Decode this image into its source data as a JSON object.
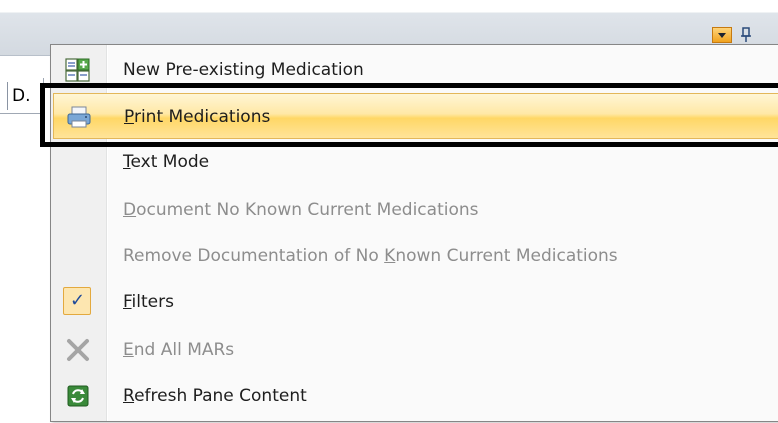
{
  "background": {
    "column_cell_text": "D."
  },
  "menu": {
    "items": [
      {
        "prefix": "",
        "hotkey": "",
        "rest": "New Pre-existing Medication",
        "icon": "new-medication-icon",
        "enabled": true,
        "highlighted": false,
        "checked": false
      },
      {
        "prefix": "",
        "hotkey": "P",
        "rest": "rint Medications",
        "icon": "print-icon",
        "enabled": true,
        "highlighted": true,
        "checked": false
      },
      {
        "prefix": "",
        "hotkey": "T",
        "rest": "ext Mode",
        "icon": "",
        "enabled": true,
        "highlighted": false,
        "checked": false
      },
      {
        "prefix": "",
        "hotkey": "D",
        "rest": "ocument No Known Current Medications",
        "icon": "",
        "enabled": false,
        "highlighted": false,
        "checked": false
      },
      {
        "prefix": "Remove Documentation of No ",
        "hotkey": "K",
        "rest": "nown Current Medications",
        "icon": "",
        "enabled": false,
        "highlighted": false,
        "checked": false
      },
      {
        "prefix": "",
        "hotkey": "F",
        "rest": "ilters",
        "icon": "checkmark-icon",
        "enabled": true,
        "highlighted": false,
        "checked": true
      },
      {
        "prefix": "",
        "hotkey": "E",
        "rest": "nd All MARs",
        "icon": "x-icon",
        "enabled": false,
        "highlighted": false,
        "checked": false
      },
      {
        "prefix": "",
        "hotkey": "R",
        "rest": "efresh Pane Content",
        "icon": "refresh-icon",
        "enabled": true,
        "highlighted": false,
        "checked": false
      }
    ],
    "check_glyph": "✓"
  },
  "colors": {
    "highlight_border": "#000000",
    "menu_hover": "#ffd766",
    "disabled_text": "#8d8d8d"
  }
}
